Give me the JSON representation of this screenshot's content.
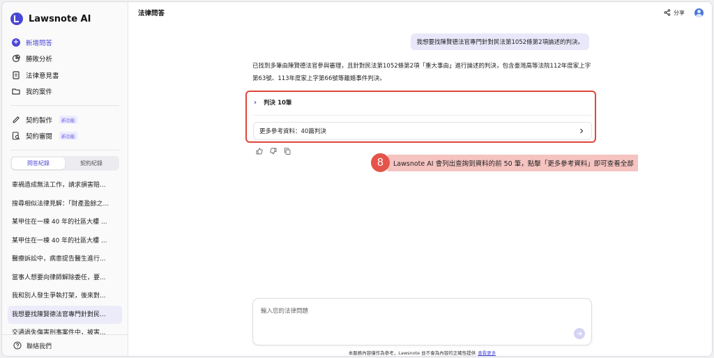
{
  "app": {
    "name": "Lawsnote AI"
  },
  "sidebar": {
    "menu": [
      {
        "label": "新增問答",
        "icon": "plus-circle-icon"
      },
      {
        "label": "勝敗分析",
        "icon": "pie-chart-icon"
      },
      {
        "label": "法律意見書",
        "icon": "document-icon"
      },
      {
        "label": "我的案件",
        "icon": "folder-icon"
      }
    ],
    "tools": [
      {
        "label": "契約製作",
        "badge": "新功能",
        "icon": "pen-icon"
      },
      {
        "label": "契約審閱",
        "badge": "新功能",
        "icon": "review-icon"
      }
    ],
    "tabs": {
      "qa": "問答紀錄",
      "contract": "契約紀錄"
    },
    "history": [
      "車禍造成無法工作，請求損害賠...",
      "搜尋相似法律見解：「財產盈餘之...",
      "某甲住在一棟 40 年的社區大樓 ...",
      "某甲住在一棟 40 年的社區大樓 ...",
      "醫療訴訟中，病患提告醫生進行...",
      "當事人想要向律師解除委任，要...",
      "我和別人發生爭執打架，後來對...",
      "我想要找陳賢德法官專門針對民...",
      "交通過失傷害刑事案件中，被害..."
    ],
    "contact": "聯絡我們"
  },
  "header": {
    "title": "法律問答",
    "share": "分享"
  },
  "chat": {
    "user_message": "我想要找陳賢德法官專門針對民法第1052條第2項論述的判決。",
    "answer_line1": "已找到多筆由陳賢德法官參與審理，且針對民法第1052條第2項「重大事由」進行論述的判決，包含臺灣高等法院112年度家上字",
    "answer_line2": "第63號、113年度家上字第66號等離婚事件判決。",
    "rulings_label": "判決 10筆",
    "more_refs": "更多參考資料：40篇判決"
  },
  "callout": {
    "number": "8",
    "text": "Lawsnote AI 會列出查詢到資料的前 50 筆，點擊「更多參考資料」即可查看全部"
  },
  "composer": {
    "placeholder": "輸入您的法律問題"
  },
  "disclaimer": {
    "text": "本服務內容僅作為參考，Lawsnote 並不會為內容的正確性提供",
    "link": "查看更多"
  },
  "colors": {
    "accent": "#4b47d6",
    "highlight": "#e0443b",
    "callout_bg": "#f5c3c0"
  }
}
